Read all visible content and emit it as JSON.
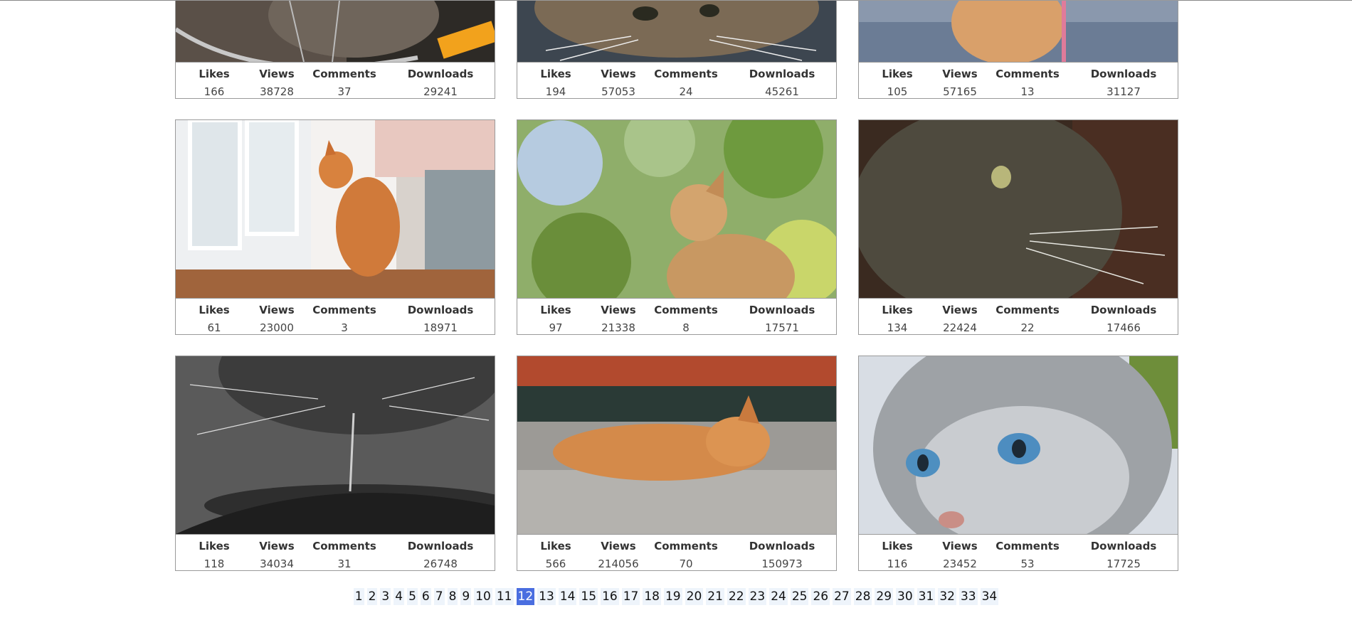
{
  "cards": [
    {
      "alt": "cat-behind-bicycle-wheel",
      "likes": "166",
      "views": "38728",
      "comments": "37",
      "downloads": "29241"
    },
    {
      "alt": "tabby-cat-lying",
      "likes": "194",
      "views": "57053",
      "comments": "24",
      "downloads": "45261"
    },
    {
      "alt": "ginger-cat-on-leash",
      "likes": "105",
      "views": "57165",
      "comments": "13",
      "downloads": "31127"
    },
    {
      "alt": "ginger-cat-at-window",
      "likes": "61",
      "views": "23000",
      "comments": "3",
      "downloads": "18971"
    },
    {
      "alt": "cat-sniffing-air",
      "likes": "97",
      "views": "21338",
      "comments": "8",
      "downloads": "17571"
    },
    {
      "alt": "tabby-cat-profile-dark",
      "likes": "134",
      "views": "22424",
      "comments": "22",
      "downloads": "17466"
    },
    {
      "alt": "cat-drinking-water-bw",
      "likes": "118",
      "views": "34034",
      "comments": "31",
      "downloads": "26748"
    },
    {
      "alt": "sleeping-ginger-kitten",
      "likes": "566",
      "views": "214056",
      "comments": "70",
      "downloads": "150973"
    },
    {
      "alt": "blue-eyed-tabby-closeup",
      "likes": "116",
      "views": "23452",
      "comments": "53",
      "downloads": "17725"
    }
  ],
  "labels": {
    "likes": "Likes",
    "views": "Views",
    "comments": "Comments",
    "downloads": "Downloads"
  },
  "pagination": {
    "pages": [
      "1",
      "2",
      "3",
      "4",
      "5",
      "6",
      "7",
      "8",
      "9",
      "10",
      "11",
      "12",
      "13",
      "14",
      "15",
      "16",
      "17",
      "18",
      "19",
      "20",
      "21",
      "22",
      "23",
      "24",
      "25",
      "26",
      "27",
      "28",
      "29",
      "30",
      "31",
      "32",
      "33",
      "34"
    ],
    "current": "12"
  },
  "colors": {
    "active_page": "#4a6ee0",
    "page_bg": "#eef4fb"
  }
}
